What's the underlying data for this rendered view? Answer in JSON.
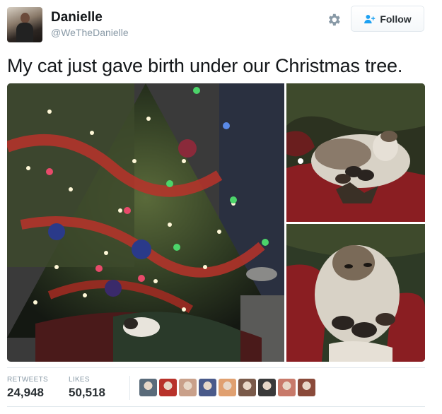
{
  "author": {
    "name": "Danielle",
    "handle": "@WeTheDanielle",
    "avatar": "profile-photo"
  },
  "actions": {
    "settings_icon": "gear-icon",
    "follow_label": "Follow",
    "follow_icon": "add-user-icon"
  },
  "tweet": {
    "text": "My cat just gave birth under our Christmas tree."
  },
  "media": {
    "photos": [
      "christmas-tree-with-cat",
      "cat-nursing-kittens",
      "cat-nursing-kittens-closeup"
    ]
  },
  "stats": {
    "retweets_label": "RETWEETS",
    "retweets_value": "24,948",
    "likes_label": "LIKES",
    "likes_value": "50,518"
  },
  "likers": {
    "count_shown": 9,
    "colors": [
      "#5a6b7a",
      "#b8322a",
      "#c9a08a",
      "#4a5a8a",
      "#e0a070",
      "#7a5a4a",
      "#3a3a3a",
      "#c87a6a",
      "#8a4a3a"
    ]
  },
  "colors": {
    "text": "#14171a",
    "secondary": "#8899a6",
    "follow_blue": "#1da1f2",
    "border": "#e1e8ed"
  }
}
